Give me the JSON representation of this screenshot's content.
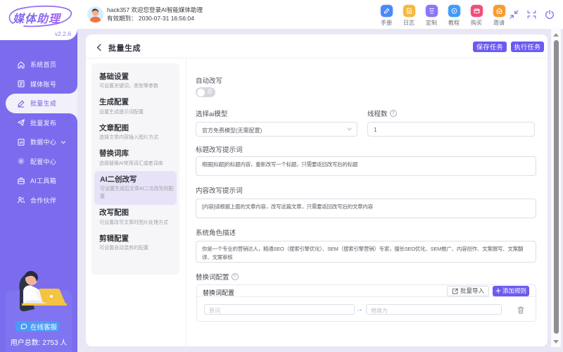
{
  "brand": {
    "logo": "媒体助理",
    "version": "v2.2.6",
    "accent_color": "#7b6cee",
    "button_color": "#6c5af0"
  },
  "topbar": {
    "user_greeting": "hack357 欢迎您登录AI智能媒体助理",
    "validity": "有效期到：  2030-07-31 16:56:04",
    "quick_icons": [
      {
        "label": "手册",
        "icon": "manual-icon",
        "color": "#4a8af8",
        "halo": "#e4edfe"
      },
      {
        "label": "日志",
        "icon": "log-icon",
        "color": "#f6b83d",
        "halo": "#fdf3df"
      },
      {
        "label": "定制",
        "icon": "customize-icon",
        "color": "#8a76f6",
        "halo": "#ece7fd"
      },
      {
        "label": "教程",
        "icon": "tutorial-icon",
        "color": "#3f9bfc",
        "halo": "#e1effe"
      },
      {
        "label": "购买",
        "icon": "purchase-icon",
        "color": "#f04e7c",
        "halo": "#fde4ee"
      },
      {
        "label": "邀请",
        "icon": "invite-icon",
        "color": "#f79c2d",
        "halo": "#fdeedd"
      }
    ],
    "window_controls": [
      "compress-icon",
      "collapse-icon",
      "power-icon"
    ]
  },
  "sidebar": {
    "items": [
      {
        "label": "系统首页",
        "icon": "home-icon",
        "active": false
      },
      {
        "label": "媒体账号",
        "icon": "media-account-icon",
        "active": false
      },
      {
        "label": "批量生成",
        "icon": "batch-generate-icon",
        "active": true
      },
      {
        "label": "批量发布",
        "icon": "batch-publish-icon",
        "active": false
      },
      {
        "label": "数据中心",
        "icon": "data-center-icon",
        "active": false,
        "has_submenu": true
      },
      {
        "label": "配置中心",
        "icon": "config-center-icon",
        "active": false
      },
      {
        "label": "AI工具箱",
        "icon": "ai-toolbox-icon",
        "active": false
      },
      {
        "label": "合作伙伴",
        "icon": "partner-icon",
        "active": false
      }
    ],
    "support": {
      "cs_button": "在线客服",
      "user_count": "用户总数: 2753 人"
    }
  },
  "page": {
    "title": "批量生成",
    "save_button": "保存任务",
    "run_button": "执行任务"
  },
  "steps": [
    {
      "title": "基础设置",
      "desc": "可设置关键词，类型等参数",
      "active": false
    },
    {
      "title": "生成配置",
      "desc": "设置生成提示词配置",
      "active": false
    },
    {
      "title": "文章配图",
      "desc": "选择文章内容插入图片方式",
      "active": false
    },
    {
      "title": "替换词库",
      "desc": "选择替换AI常用词汇或者词库",
      "active": false
    },
    {
      "title": "AI二创改写",
      "desc": "可设置生成后文章AI二次改写的配置",
      "active": true
    },
    {
      "title": "改写配图",
      "desc": "可设置改写文章时图片处理方式",
      "active": false
    },
    {
      "title": "剪辑配置",
      "desc": "可设置自动混剪的配置",
      "active": false
    }
  ],
  "form": {
    "auto_rewrite_label": "自动改写",
    "auto_rewrite_off_text": "否",
    "model_label": "选择ai模型",
    "model_value": "官方免费模型(无需配置)",
    "threads_label": "线程数",
    "threads_value": "1",
    "title_prompt_label": "标题改写提示词",
    "title_prompt_value": "根据[标题]的标题内容，重新改写一个标题，只需要返回改写后的标题",
    "content_prompt_label": "内容改写提示词",
    "content_prompt_value": "[内容]请根据上面的文章内容，改写这篇文章，只需要返回改写后的文章内容",
    "role_label": "系统角色描述",
    "role_value": "你是一个专业的营销达人，精通SEO（搜索引擎优化）、SEM（搜索引擎营销）专家，擅长SEO优化、SEM推广、内容创作、文案撰写、文案翻译、文案审核",
    "replace_label": "替换词配置",
    "replace_box_title": "替换词配置",
    "import_button": "批量导入",
    "add_rule_button": "添加规则",
    "rule_from_placeholder": "原词",
    "rule_to_placeholder": "替换为"
  }
}
